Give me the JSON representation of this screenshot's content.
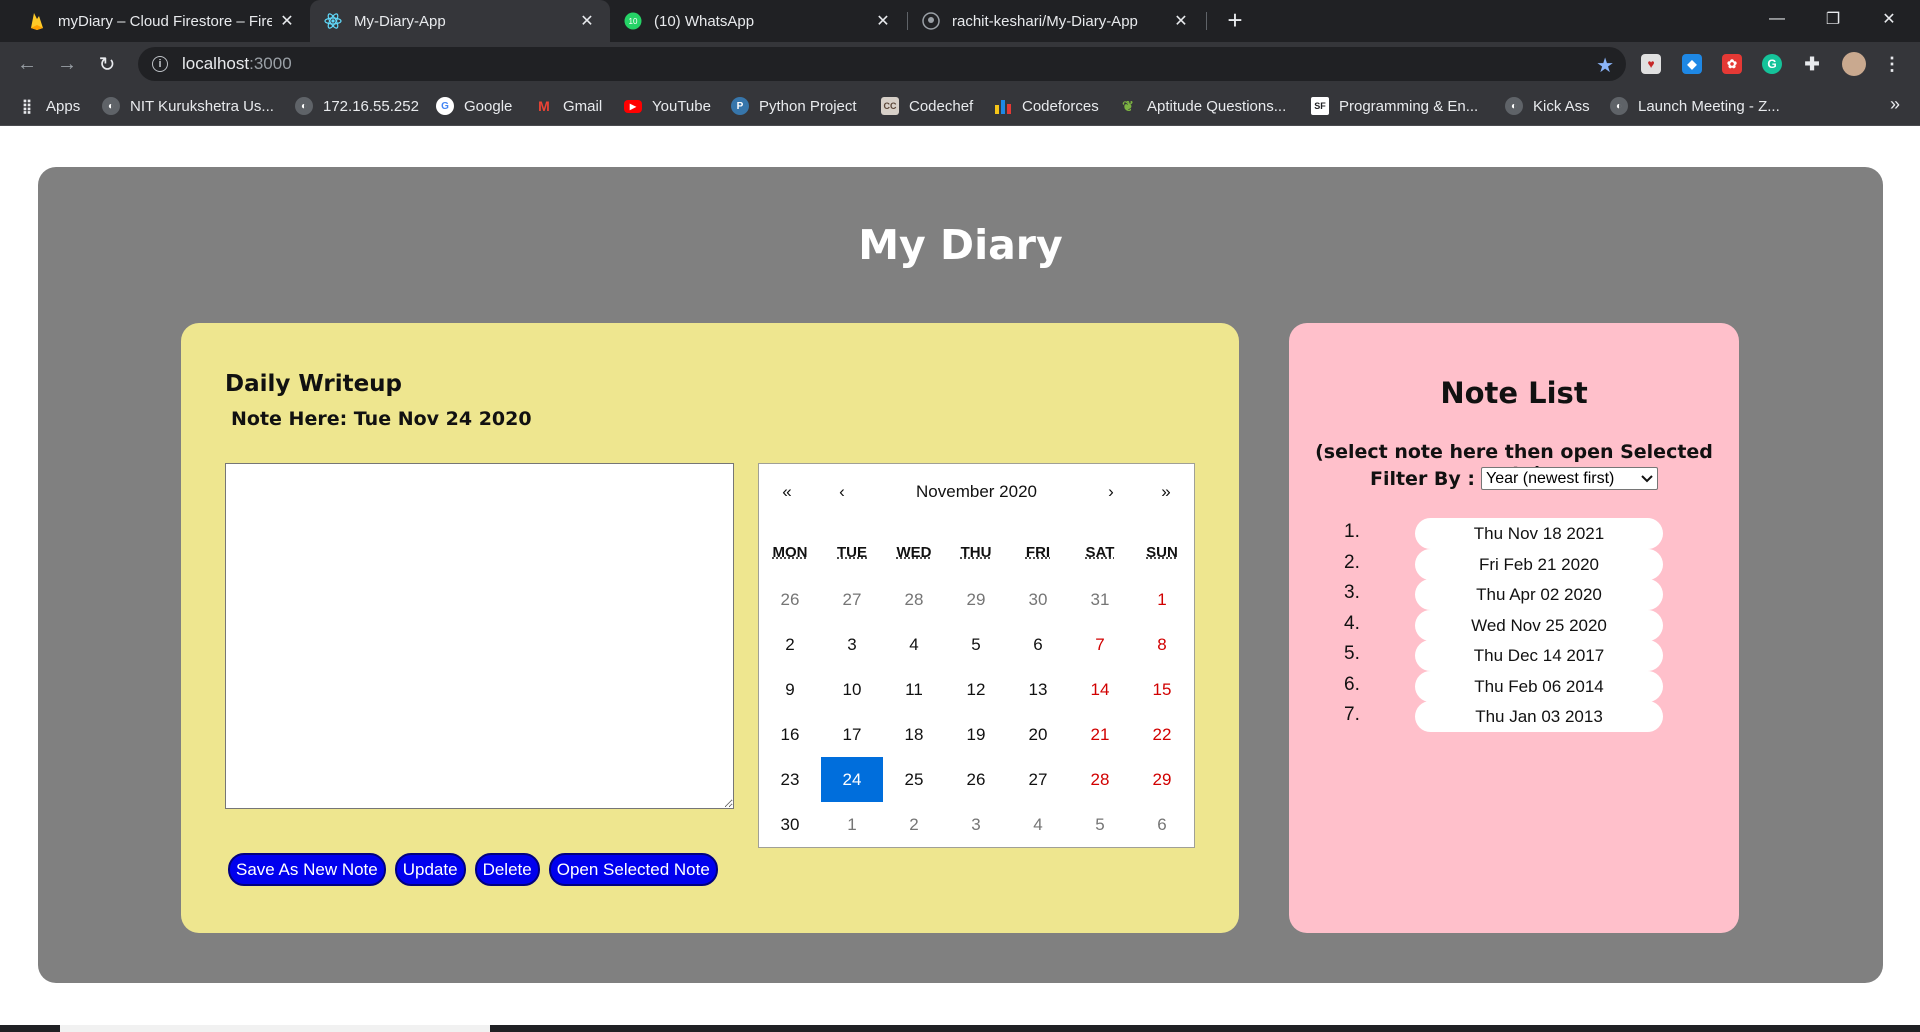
{
  "browser": {
    "tabs": [
      {
        "title": "myDiary – Cloud Firestore – Fireb",
        "icon": "firebase-icon"
      },
      {
        "title": "My-Diary-App",
        "icon": "react-icon"
      },
      {
        "title": "(10) WhatsApp",
        "icon": "whatsapp-icon"
      },
      {
        "title": "rachit-keshari/My-Diary-App",
        "icon": "github-icon"
      }
    ],
    "url_host": "localhost",
    "url_port": ":3000",
    "bookmarks": [
      {
        "label": "Apps"
      },
      {
        "label": "NIT Kurukshetra Us..."
      },
      {
        "label": "172.16.55.252"
      },
      {
        "label": "Google"
      },
      {
        "label": "Gmail"
      },
      {
        "label": "YouTube"
      },
      {
        "label": "Python Project"
      },
      {
        "label": "Codechef"
      },
      {
        "label": "Codeforces"
      },
      {
        "label": "Aptitude Questions..."
      },
      {
        "label": "Programming & En..."
      },
      {
        "label": "Kick Ass"
      },
      {
        "label": "Launch Meeting - Z..."
      }
    ]
  },
  "app": {
    "title": "My Diary",
    "writeup": {
      "heading": "Daily Writeup",
      "note_here": "Note Here: Tue Nov 24 2020",
      "textarea_value": "",
      "buttons": {
        "save_new": "Save As New Note",
        "update": "Update",
        "delete": "Delete",
        "open_selected": "Open Selected Note"
      }
    },
    "calendar": {
      "nav": {
        "prev_year": "«",
        "prev_month": "‹",
        "label": "November 2020",
        "next_month": "›",
        "next_year": "»"
      },
      "weekdays": [
        "MON",
        "TUE",
        "WED",
        "THU",
        "FRI",
        "SAT",
        "SUN"
      ],
      "days": [
        {
          "d": "26",
          "other": true
        },
        {
          "d": "27",
          "other": true
        },
        {
          "d": "28",
          "other": true
        },
        {
          "d": "29",
          "other": true
        },
        {
          "d": "30",
          "other": true
        },
        {
          "d": "31",
          "other": true
        },
        {
          "d": "1",
          "weekend": true
        },
        {
          "d": "2"
        },
        {
          "d": "3"
        },
        {
          "d": "4"
        },
        {
          "d": "5"
        },
        {
          "d": "6"
        },
        {
          "d": "7",
          "weekend": true
        },
        {
          "d": "8",
          "weekend": true
        },
        {
          "d": "9"
        },
        {
          "d": "10"
        },
        {
          "d": "11"
        },
        {
          "d": "12"
        },
        {
          "d": "13"
        },
        {
          "d": "14",
          "weekend": true
        },
        {
          "d": "15",
          "weekend": true
        },
        {
          "d": "16"
        },
        {
          "d": "17"
        },
        {
          "d": "18"
        },
        {
          "d": "19"
        },
        {
          "d": "20"
        },
        {
          "d": "21",
          "weekend": true
        },
        {
          "d": "22",
          "weekend": true
        },
        {
          "d": "23"
        },
        {
          "d": "24",
          "selected": true
        },
        {
          "d": "25"
        },
        {
          "d": "26"
        },
        {
          "d": "27"
        },
        {
          "d": "28",
          "weekend": true
        },
        {
          "d": "29",
          "weekend": true
        },
        {
          "d": "30"
        },
        {
          "d": "1",
          "other": true
        },
        {
          "d": "2",
          "other": true
        },
        {
          "d": "3",
          "other": true
        },
        {
          "d": "4",
          "other": true
        },
        {
          "d": "5",
          "other": true
        },
        {
          "d": "6",
          "other": true
        }
      ]
    },
    "note_list": {
      "title": "Note List",
      "help": "(select note here then open Selected note)",
      "filter_label": "Filter By :",
      "filter_value": "Year (newest first)",
      "notes": [
        {
          "num": "1.",
          "date": "Thu Nov 18 2021"
        },
        {
          "num": "2.",
          "date": "Fri Feb 21 2020"
        },
        {
          "num": "3.",
          "date": "Thu Apr 02 2020"
        },
        {
          "num": "4.",
          "date": "Wed Nov 25 2020"
        },
        {
          "num": "5.",
          "date": "Thu Dec 14 2017"
        },
        {
          "num": "6.",
          "date": "Thu Feb 06 2014"
        },
        {
          "num": "7.",
          "date": "Thu Jan 03 2013"
        }
      ]
    }
  },
  "colors": {
    "outer_panel": "#808080",
    "writeup_panel": "#eee68f",
    "notelist_panel": "#ffc0cb",
    "button_bg": "#0000ee",
    "calendar_selected": "#006edc",
    "weekend_text": "#d10000"
  }
}
